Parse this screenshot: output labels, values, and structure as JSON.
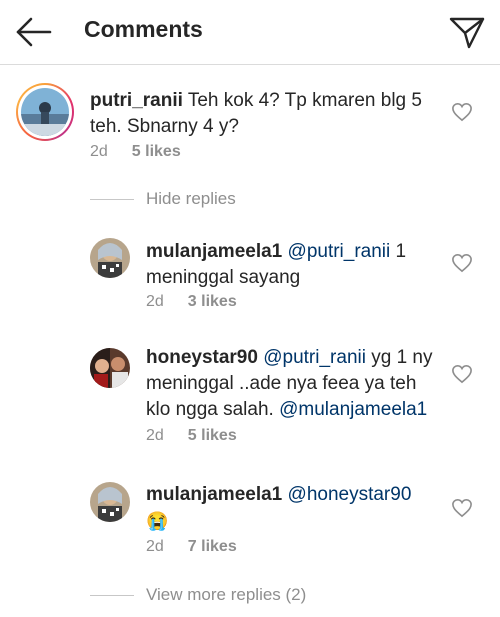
{
  "header": {
    "title": "Comments",
    "back_icon": "arrow-left-icon",
    "send_icon": "paper-plane-icon"
  },
  "comments": [
    {
      "username": "putri_ranii",
      "text": "Teh kok 4? Tp kmaren blg 5 teh. Sbnarny 4 y?",
      "age": "2d",
      "likes": "5 likes"
    }
  ],
  "hide_replies": "Hide replies",
  "replies": [
    {
      "username": "mulanjameela1",
      "mention": "@putri_ranii",
      "text": "1 meninggal sayang",
      "age": "2d",
      "likes": "3 likes"
    },
    {
      "username": "honeystar90",
      "mention": "@putri_ranii",
      "text": "yg 1 ny meninggal ..ade nya feea ya teh klo ngga salah.",
      "mention2": "@mulanjameela1",
      "age": "2d",
      "likes": "5 likes"
    },
    {
      "username": "mulanjameela1",
      "mention": "@honeystar90",
      "text": "😭",
      "age": "2d",
      "likes": "7 likes"
    }
  ],
  "view_more_replies": "View more replies (2)",
  "colors": {
    "text": "#262626",
    "secondary": "#8e8e8e",
    "mention": "#003569",
    "divider": "#dbdbdb"
  }
}
